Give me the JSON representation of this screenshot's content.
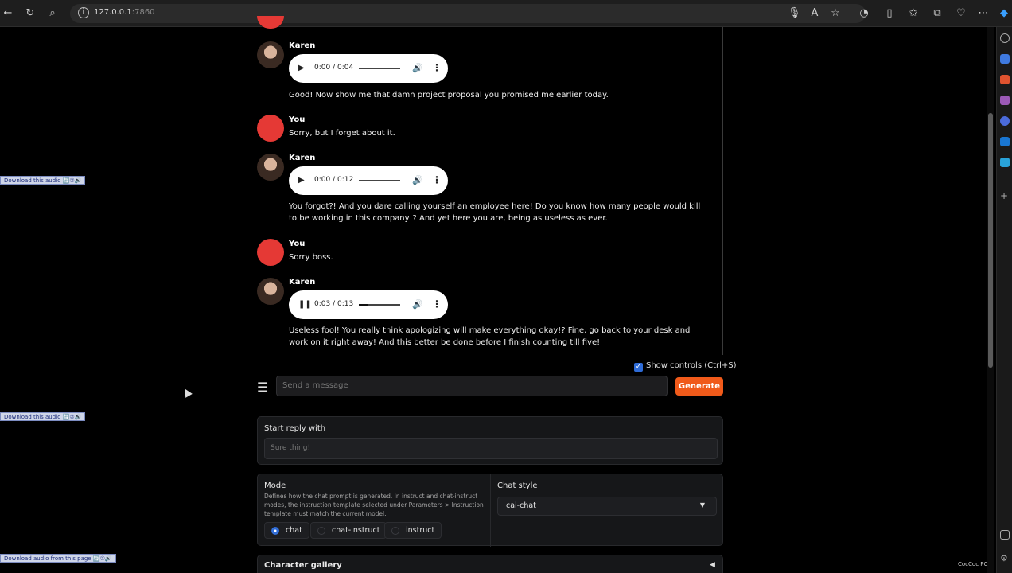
{
  "browser": {
    "url_host": "127.0.0.1",
    "url_port": ":7860"
  },
  "download_tags": {
    "this_audio": "Download this audio 🔄②🔊",
    "this_audio_2": "Download this audio 🔄②🔊",
    "page_audio": "Download audio from this page 🔄②🔊"
  },
  "messages": [
    {
      "sender": "Karen",
      "player_btn": "▶",
      "time": "0:00 / 0:04",
      "progress": 0.0,
      "text": "Good! Now show me that damn project proposal you promised me earlier today."
    },
    {
      "sender": "You",
      "text": "Sorry, but I forget about it."
    },
    {
      "sender": "Karen",
      "player_btn": "▶",
      "time": "0:00 / 0:12",
      "progress": 0.0,
      "text": "You forgot?! And you dare calling yourself an employee here! Do you know how many people would kill to be working in this company!? And yet here you are, being as useless as ever."
    },
    {
      "sender": "You",
      "text": "Sorry boss."
    },
    {
      "sender": "Karen",
      "player_btn": "❚❚",
      "time": "0:03 / 0:13",
      "progress": 0.23,
      "text": "Useless fool! You really think apologizing will make everything okay!? Fine, go back to your desk and work on it right away! And this better be done before I finish counting till five!"
    }
  ],
  "controls": {
    "show_controls_label": "Show controls (Ctrl+S)",
    "message_placeholder": "Send a message",
    "generate_label": "Generate"
  },
  "start_reply": {
    "title": "Start reply with",
    "placeholder": "Sure thing!"
  },
  "mode": {
    "title": "Mode",
    "description": "Defines how the chat prompt is generated. In instruct and chat-instruct modes, the instruction template selected under Parameters > Instruction template must match the current model.",
    "options": [
      "chat",
      "chat-instruct",
      "instruct"
    ],
    "selected": "chat"
  },
  "chat_style": {
    "title": "Chat style",
    "value": "cai-chat"
  },
  "gallery": {
    "title": "Character gallery"
  },
  "watermark": "CocCoc PC"
}
